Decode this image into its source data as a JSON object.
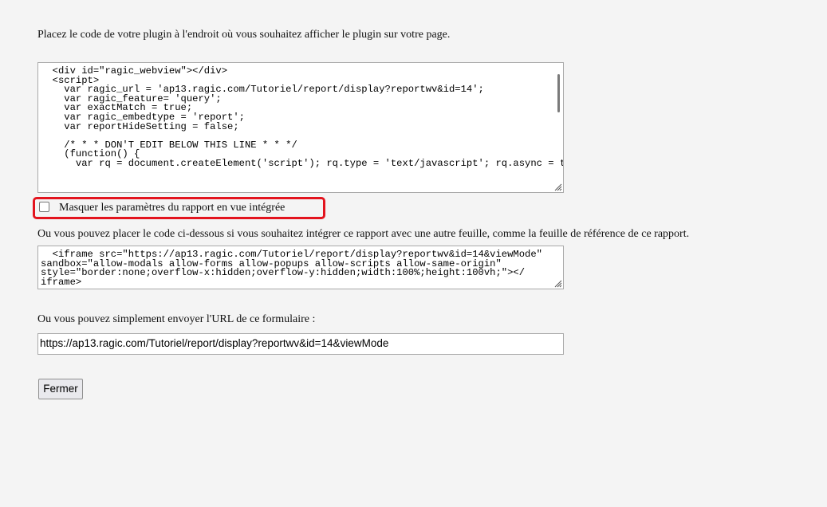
{
  "intro_text": "Placez le code de votre plugin à l'endroit où vous souhaitez afficher le plugin sur votre page.",
  "plugin_code": "  <div id=\"ragic_webview\"></div>\n  <script>\n    var ragic_url = 'ap13.ragic.com/Tutoriel/report/display?reportwv&id=14';\n    var ragic_feature= 'query';\n    var exactMatch = true;\n    var ragic_embedtype = 'report';\n    var reportHideSetting = false;\n\n    /* * * DON'T EDIT BELOW THIS LINE * * */\n    (function() {\n      var rq = document.createElement('script'); rq.type = 'text/javascript'; rq.async = true;",
  "hide_settings_label": "Masquer les paramètres du rapport en vue intégrée",
  "hide_settings_checked": false,
  "iframe_intro_text": "Ou vous pouvez placer le code ci-dessous si vous souhaitez intégrer ce rapport avec une autre feuille, comme la feuille de référence de ce rapport.",
  "iframe_code": "  <iframe src=\"https://ap13.ragic.com/Tutoriel/report/display?reportwv&id=14&viewMode\"\nsandbox=\"allow-modals allow-forms allow-popups allow-scripts allow-same-origin\"\nstyle=\"border:none;overflow-x:hidden;overflow-y:hidden;width:100%;height:100vh;\"></\niframe>",
  "url_intro_text": "Ou vous pouvez simplement envoyer l'URL de ce formulaire :",
  "url_value": "https://ap13.ragic.com/Tutoriel/report/display?reportwv&id=14&viewMode",
  "close_label": "Fermer",
  "colors": {
    "highlight": "#e3141e",
    "background": "#f4f4f4"
  }
}
